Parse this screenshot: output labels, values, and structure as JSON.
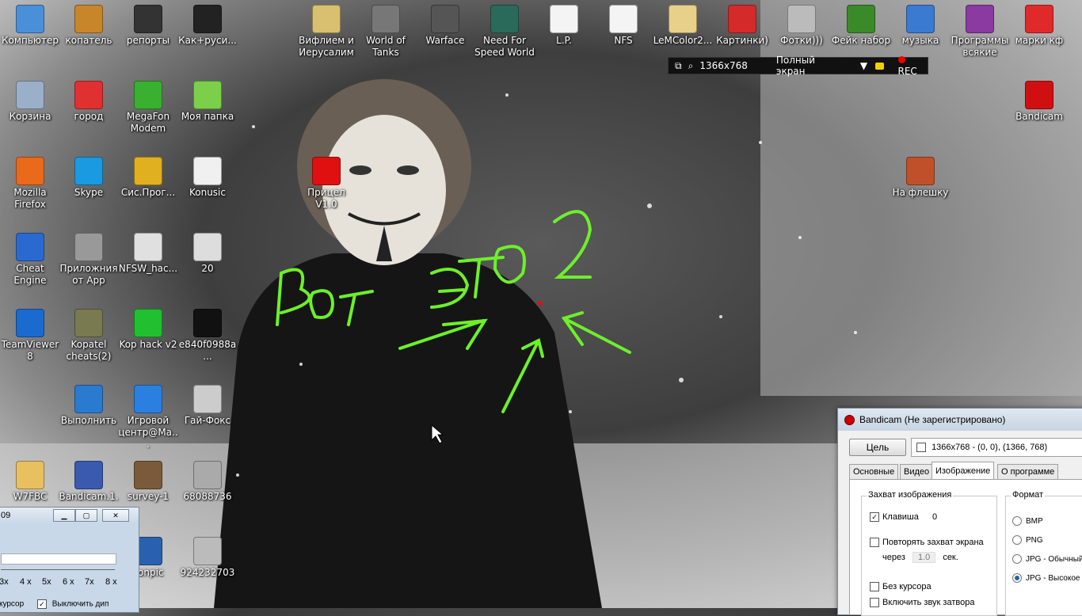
{
  "desktop_icons": [
    {
      "label": "Компьютер",
      "icon": "computer-icon",
      "color": "#4a90d9"
    },
    {
      "label": "копатель",
      "icon": "app-icon",
      "color": "#c8862a"
    },
    {
      "label": "репорты",
      "icon": "folder-icon",
      "color": "#333333"
    },
    {
      "label": "Как+руси...",
      "icon": "app-icon",
      "color": "#222222"
    },
    {
      "label": "Вифлием и Иерусалим",
      "icon": "folder-icon",
      "color": "#d8c070"
    },
    {
      "label": "World of Tanks",
      "icon": "game-icon",
      "color": "#777777"
    },
    {
      "label": "Warface",
      "icon": "game-icon",
      "color": "#555555"
    },
    {
      "label": "Need For Speed World",
      "icon": "game-icon",
      "color": "#2a6a5a"
    },
    {
      "label": "L.P.",
      "icon": "document-icon",
      "color": "#f4f4f4"
    },
    {
      "label": "NFS",
      "icon": "document-icon",
      "color": "#f4f4f4"
    },
    {
      "label": "LeMColor2...",
      "icon": "folder-icon",
      "color": "#e8d08a"
    },
    {
      "label": "Картинки)",
      "icon": "dice-icon",
      "color": "#d42a2a"
    },
    {
      "label": "Фотки)))",
      "icon": "camera-icon",
      "color": "#bbbbbb"
    },
    {
      "label": "Фейк набор",
      "icon": "app-icon",
      "color": "#3a8a2a"
    },
    {
      "label": "музыка",
      "icon": "music-icon",
      "color": "#3a7ad0"
    },
    {
      "label": "Программы всякие",
      "icon": "archive-icon",
      "color": "#8a3aa0"
    },
    {
      "label": "марки кф",
      "icon": "app-icon",
      "color": "#e02a2a"
    },
    {
      "label": "Корзина",
      "icon": "recycle-bin-icon",
      "color": "#9ab0c8"
    },
    {
      "label": "город",
      "icon": "document-icon",
      "color": "#e03030"
    },
    {
      "label": "MegaFon Modem",
      "icon": "modem-icon",
      "color": "#3ab030"
    },
    {
      "label": "Моя папка",
      "icon": "folder-icon",
      "color": "#7ad04a"
    },
    {
      "label": "Bandicam",
      "icon": "record-icon",
      "color": "#d01010"
    },
    {
      "label": "Mozilla Firefox",
      "icon": "firefox-icon",
      "color": "#e86a1a"
    },
    {
      "label": "Skype",
      "icon": "skype-icon",
      "color": "#1a9ae0"
    },
    {
      "label": "Сис.Прог...",
      "icon": "app-icon",
      "color": "#e0b020"
    },
    {
      "label": "Konusic",
      "icon": "chess-icon",
      "color": "#f0f0f0"
    },
    {
      "label": "Прицел V1.0",
      "icon": "crosshair-icon",
      "color": "#e01010"
    },
    {
      "label": "На флешку",
      "icon": "app-icon",
      "color": "#c0502a"
    },
    {
      "label": "Cheat Engine",
      "icon": "app-icon",
      "color": "#2a6ad0"
    },
    {
      "label": "Приложния от App",
      "icon": "clock-icon",
      "color": "#999999"
    },
    {
      "label": "NFSW_hac...",
      "icon": "document-icon",
      "color": "#e0e0e0"
    },
    {
      "label": "20",
      "icon": "app-icon",
      "color": "#dddddd"
    },
    {
      "label": "TeamViewer 8",
      "icon": "teamviewer-icon",
      "color": "#1a6ad0"
    },
    {
      "label": "Kopatel cheats(2)",
      "icon": "app-icon",
      "color": "#7a7a50"
    },
    {
      "label": "Kop hack v2",
      "icon": "star-icon",
      "color": "#20c030"
    },
    {
      "label": "e840f0988a...",
      "icon": "image-icon",
      "color": "#111111"
    },
    {
      "label": "Выполнить",
      "icon": "run-icon",
      "color": "#2a7ad0"
    },
    {
      "label": "Игровой центр@Ма...",
      "icon": "app-icon",
      "color": "#2a80e0"
    },
    {
      "label": "Гай-Фокс",
      "icon": "image-icon",
      "color": "#cccccc"
    },
    {
      "label": "W7FBC",
      "icon": "folder-icon",
      "color": "#e8c060"
    },
    {
      "label": "Bandicam.1...",
      "icon": "globe-icon",
      "color": "#3a5ab0"
    },
    {
      "label": "survey-1",
      "icon": "image-icon",
      "color": "#7a5a3a"
    },
    {
      "label": "68088736",
      "icon": "image-icon",
      "color": "#aaaaaa"
    },
    {
      "label": "konpic",
      "icon": "app-icon",
      "color": "#2a60b0"
    },
    {
      "label": "924232703",
      "icon": "image-icon",
      "color": "#bbbbbb"
    }
  ],
  "rec_bar": {
    "resolution": "1366x768",
    "mode": "Полный экран",
    "rec": "REC"
  },
  "bandicam": {
    "title": "Bandicam (Не зарегистрировано)",
    "target_button": "Цель",
    "target_value": "1366x768 - (0, 0), (1366, 768)",
    "tabs": [
      "Основные",
      "Видео",
      "Изображение",
      "О программе"
    ],
    "capture_group": "Захват изображения",
    "hotkey_label": "Клавиша",
    "hotkey_value": "0",
    "repeat_label": "Повторять захват экрана",
    "every_label": "через",
    "every_value": "1.0",
    "sec_label": "сек.",
    "no_cursor": "Без курсора",
    "shutter_sound": "Включить звук затвора",
    "format_group": "Формат",
    "formats": [
      "BMP",
      "PNG",
      "JPG - Обычный",
      "JPG - Высокое"
    ],
    "selected_format": "JPG - Высокое"
  },
  "mini_window": {
    "title": "09",
    "scales": [
      "3x",
      "4 x",
      "5x",
      "6 x",
      "7x",
      "8 x"
    ],
    "cursor_label": "курсор",
    "checkbox_label": "Выключить дип"
  },
  "handwriting": "Вот это 2"
}
